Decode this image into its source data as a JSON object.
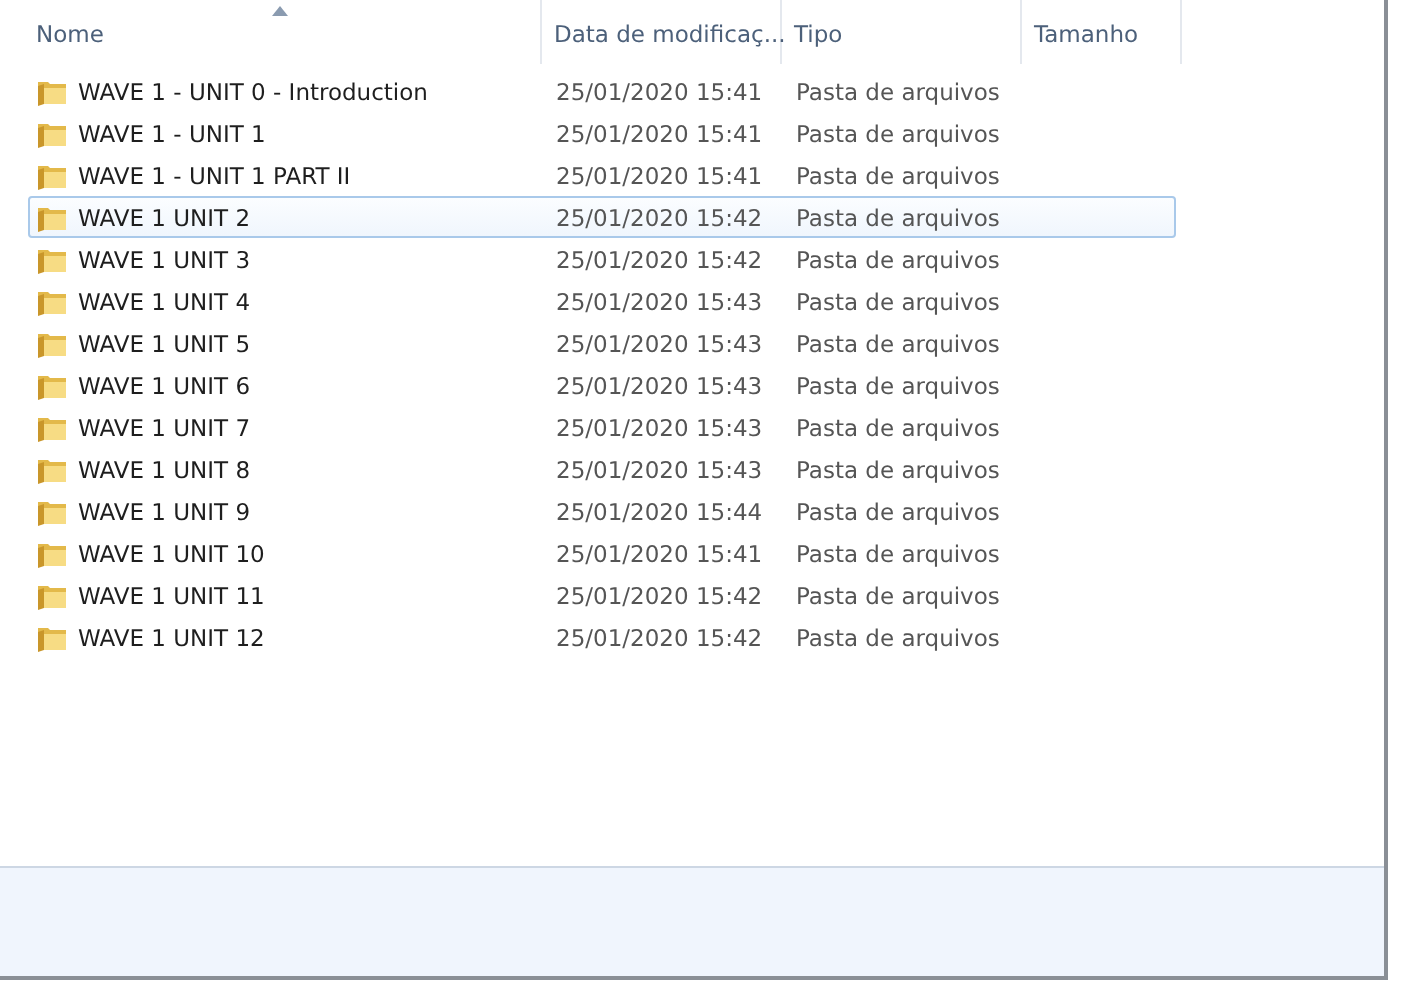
{
  "columns": [
    {
      "label": "Nome",
      "sorted": true
    },
    {
      "label": "Data de modificaç..."
    },
    {
      "label": "Tipo"
    },
    {
      "label": "Tamanho"
    }
  ],
  "rows": [
    {
      "name": "WAVE 1 - UNIT 0 - Introduction",
      "date": "25/01/2020 15:41",
      "type": "Pasta de arquivos",
      "selected": false
    },
    {
      "name": "WAVE 1 - UNIT 1",
      "date": "25/01/2020 15:41",
      "type": "Pasta de arquivos",
      "selected": false
    },
    {
      "name": "WAVE 1 - UNIT 1 PART II",
      "date": "25/01/2020 15:41",
      "type": "Pasta de arquivos",
      "selected": false
    },
    {
      "name": "WAVE 1 UNIT 2",
      "date": "25/01/2020 15:42",
      "type": "Pasta de arquivos",
      "selected": true
    },
    {
      "name": "WAVE 1 UNIT 3",
      "date": "25/01/2020 15:42",
      "type": "Pasta de arquivos",
      "selected": false
    },
    {
      "name": "WAVE 1 UNIT 4",
      "date": "25/01/2020 15:43",
      "type": "Pasta de arquivos",
      "selected": false
    },
    {
      "name": "WAVE 1 UNIT 5",
      "date": "25/01/2020 15:43",
      "type": "Pasta de arquivos",
      "selected": false
    },
    {
      "name": "WAVE 1 UNIT 6",
      "date": "25/01/2020 15:43",
      "type": "Pasta de arquivos",
      "selected": false
    },
    {
      "name": "WAVE 1 UNIT 7",
      "date": "25/01/2020 15:43",
      "type": "Pasta de arquivos",
      "selected": false
    },
    {
      "name": "WAVE 1 UNIT 8",
      "date": "25/01/2020 15:43",
      "type": "Pasta de arquivos",
      "selected": false
    },
    {
      "name": "WAVE 1 UNIT 9",
      "date": "25/01/2020 15:44",
      "type": "Pasta de arquivos",
      "selected": false
    },
    {
      "name": "WAVE 1 UNIT 10",
      "date": "25/01/2020 15:41",
      "type": "Pasta de arquivos",
      "selected": false
    },
    {
      "name": "WAVE 1 UNIT 11",
      "date": "25/01/2020 15:42",
      "type": "Pasta de arquivos",
      "selected": false
    },
    {
      "name": "WAVE 1 UNIT 12",
      "date": "25/01/2020 15:42",
      "type": "Pasta de arquivos",
      "selected": false
    }
  ]
}
